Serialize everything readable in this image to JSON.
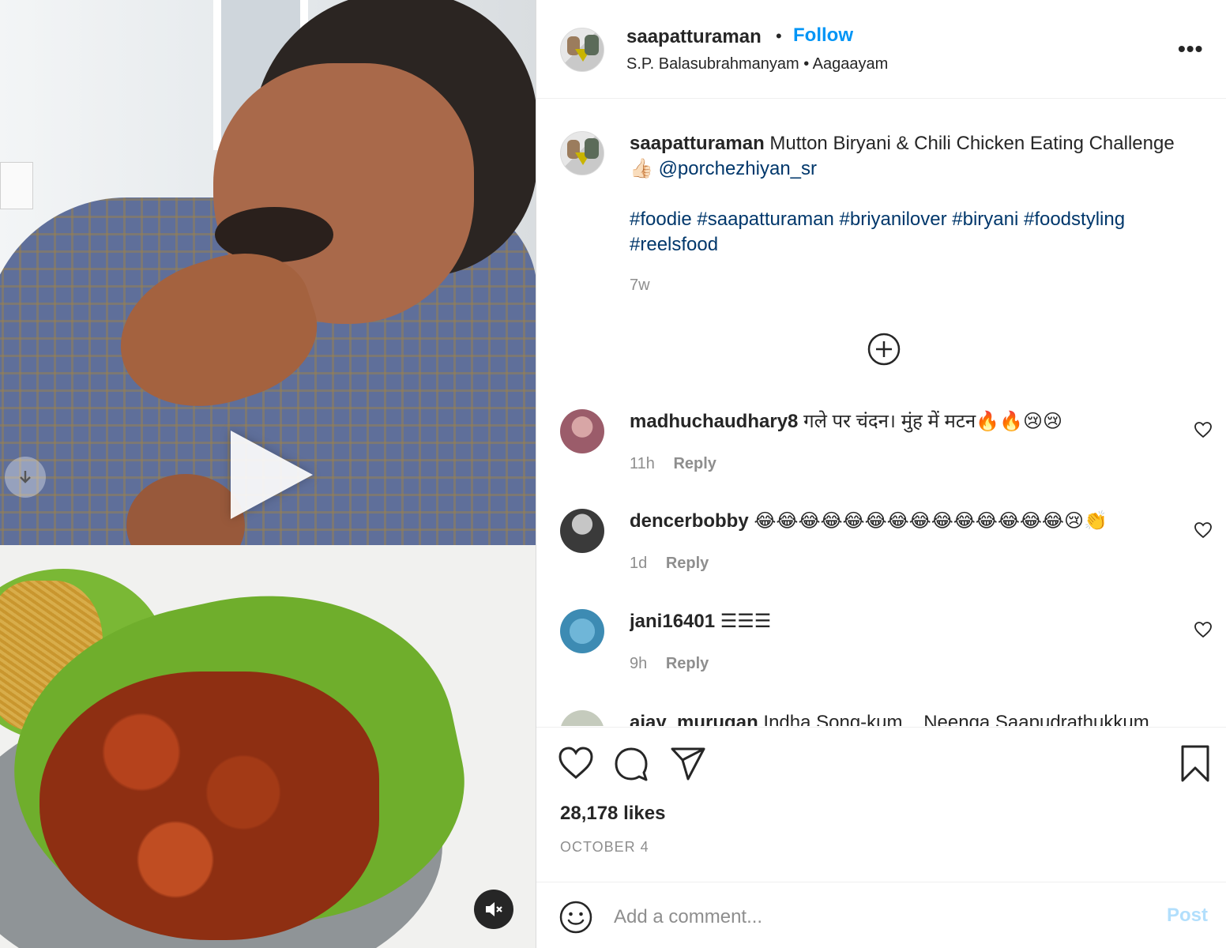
{
  "video": {
    "play_icon": "play-icon",
    "mute_icon": "muted-speaker-icon",
    "nav_icon": "down-arrow-icon"
  },
  "header": {
    "username": "saapatturaman",
    "separator": "•",
    "follow_label": "Follow",
    "audio_line": "S.P. Balasubrahmanyam • Aagaayam",
    "more_icon": "more-options-icon",
    "more_glyph": "•••"
  },
  "post": {
    "username": "saapatturaman",
    "caption_text": "Mutton Biryani & Chili Chicken Eating Challenge",
    "caption_emoji": "👍🏻",
    "mention": "@porchezhiyan_sr",
    "hashtags_line1": "#foodie #saapatturaman #briyanilover #biryani #foodstyling",
    "hashtags_line2": "#reelsfood",
    "time_ago": "7w"
  },
  "load_more_icon": "plus-circle-icon",
  "comments": [
    {
      "username": "madhuchaudhary8",
      "text": "गले पर चंदन। मुंह में मटन🔥🔥😢😢",
      "time": "11h",
      "reply_label": "Reply"
    },
    {
      "username": "dencerbobby",
      "text": "😂😂😂😂😂😂😂😂😂😂😂😂😂😂😢👏",
      "time": "1d",
      "reply_label": "Reply"
    },
    {
      "username": "jani16401",
      "text": "☰☰☰",
      "time": "9h",
      "reply_label": "Reply"
    },
    {
      "username": "ajay_murugan",
      "text": "Indha Song-kum... Neenga Saapudrathukkum...",
      "time": "",
      "reply_label": ""
    }
  ],
  "actions": {
    "like_icon": "heart-icon",
    "comment_icon": "comment-bubble-icon",
    "share_icon": "paper-plane-icon",
    "save_icon": "bookmark-icon"
  },
  "likes": "28,178 likes",
  "date": "OCTOBER 4",
  "add_comment": {
    "emoji_icon": "smiley-icon",
    "placeholder": "Add a comment...",
    "post_label": "Post"
  },
  "colors": {
    "link_blue": "#0095f6",
    "hashtag_blue": "#00376b",
    "muted_text": "#8e8e8e",
    "post_disabled": "#b2dffc"
  }
}
